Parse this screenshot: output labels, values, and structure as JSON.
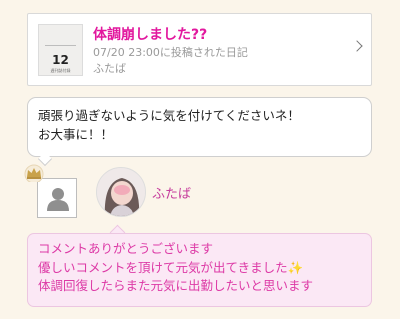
{
  "diary": {
    "title": "体調崩しました??",
    "meta": "07/20 23:00に投稿された日記",
    "author": "ふたば",
    "thumb_day": "12",
    "thumb_caption": "週刊誌付録"
  },
  "comment": {
    "line1": "頑張り過ぎないように気を付けてくださいネ！",
    "line2": "お大事に！！"
  },
  "author_name": "ふたば",
  "reply": {
    "line1": "コメントありがとうございます",
    "line2": "優しいコメントを頂けて元気が出てきました",
    "line2_emoji": "✨",
    "line3": "体調回復したらまた元気に出勤したいと思います"
  },
  "icons": {
    "crown": "crown-icon",
    "guest": "user-silhouette-icon",
    "chevron": "chevron-right-icon",
    "sparkle": "sparkle-emoji"
  },
  "colors": {
    "background": "#fbf5ea",
    "title_pink": "#e2189e",
    "reply_bg": "#fbe8f5",
    "reply_text": "#dd3aa6"
  }
}
